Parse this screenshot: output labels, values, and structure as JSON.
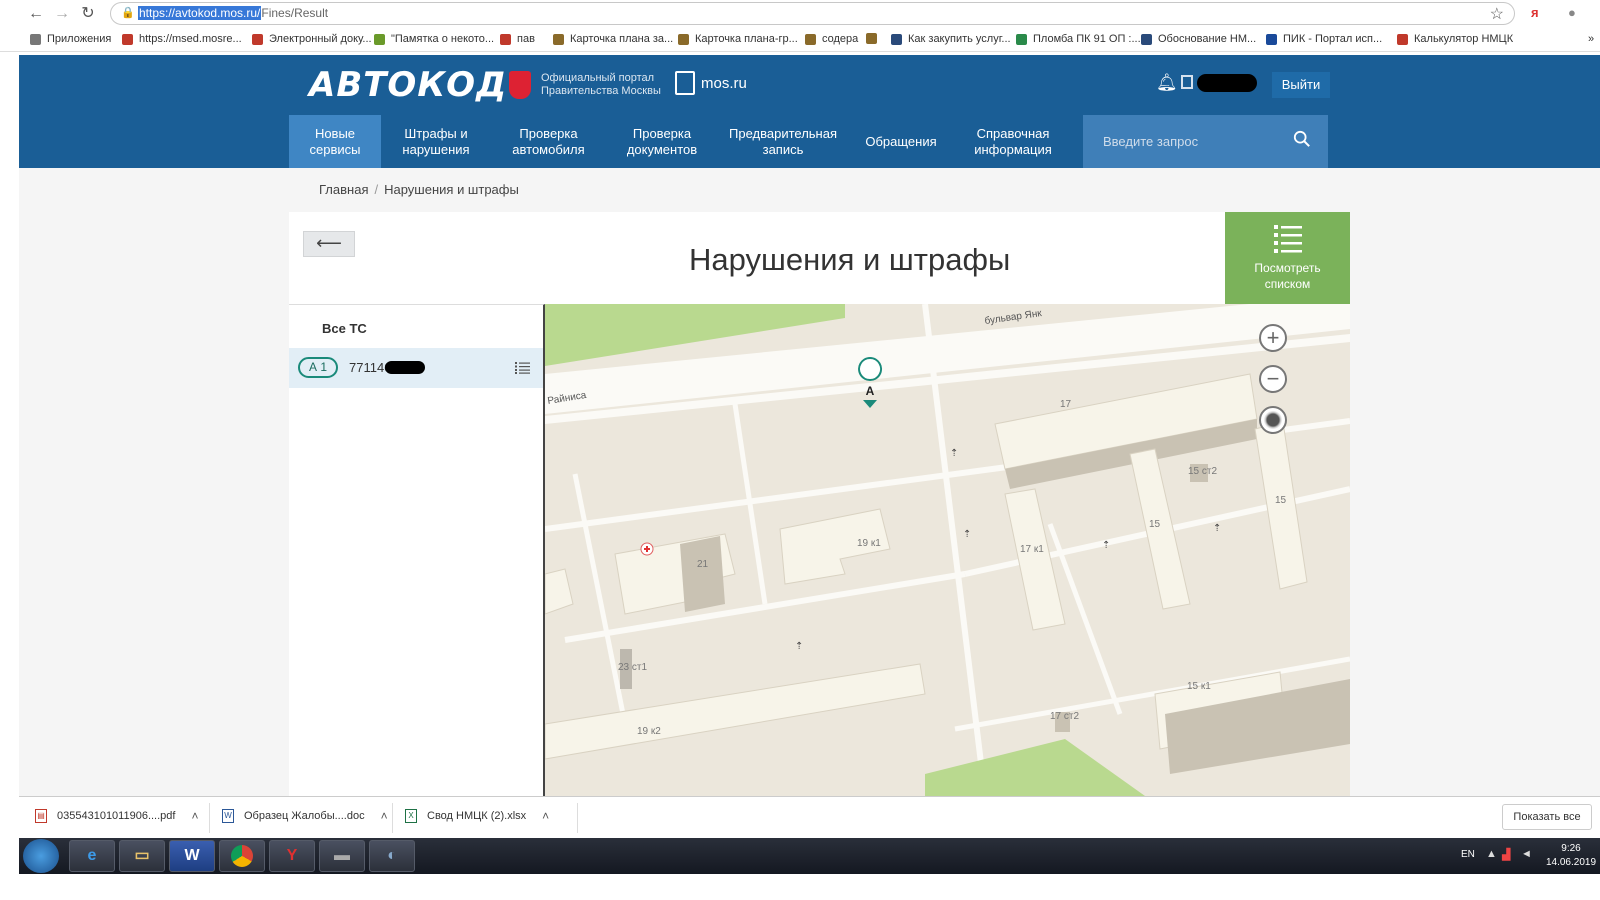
{
  "browser": {
    "url_host": "https://avtokod.mos.ru/",
    "url_path": "Fines/Result",
    "bookmarks": [
      {
        "label": "Приложения",
        "color": "#777777"
      },
      {
        "label": "https://msed.mosre...",
        "color": "#c0392b"
      },
      {
        "label": "Электронный доку...",
        "color": "#c0392b"
      },
      {
        "label": "\"Памятка о некото...",
        "color": "#6a9a2a"
      },
      {
        "label": "пав",
        "color": "#c0392b"
      },
      {
        "label": "Карточка плана за...",
        "color": "#8a6a2a"
      },
      {
        "label": "Карточка плана-гр...",
        "color": "#8a6a2a"
      },
      {
        "label": "содера",
        "color": "#8a6a2a"
      },
      {
        "label": "",
        "color": "#8a6a2a"
      },
      {
        "label": "Как закупить услуг...",
        "color": "#2a4a7a"
      },
      {
        "label": "Пломба ПК 91 ОП :...",
        "color": "#2a8a4a"
      },
      {
        "label": "Обоснование НМ...",
        "color": "#2a4a7a"
      },
      {
        "label": "ПИК - Портал исп...",
        "color": "#1a4a9a"
      },
      {
        "label": "Калькулятор НМЦК",
        "color": "#c0392b"
      }
    ]
  },
  "header": {
    "logo": "АВТОКОД",
    "portal_text": "Официальный портал Правительства Москвы",
    "mosru": "mos.ru",
    "logout": "Выйти"
  },
  "menu": {
    "items": [
      {
        "label": "Новые сервисы",
        "active": true
      },
      {
        "label": "Штрафы и нарушения",
        "active": false
      },
      {
        "label": "Проверка автомобиля",
        "active": false
      },
      {
        "label": "Проверка документов",
        "active": false
      },
      {
        "label": "Предварительная запись",
        "active": false
      },
      {
        "label": "Обращения",
        "active": false
      },
      {
        "label": "Справочная информация",
        "active": false
      }
    ],
    "search_placeholder": "Введите запрос"
  },
  "breadcrumb": {
    "home": "Главная",
    "separator": "/",
    "current": "Нарушения и штрафы"
  },
  "card": {
    "title": "Нарушения и штрафы",
    "back_label": "⟵",
    "list_button": "Посмотреть списком"
  },
  "vehicles": {
    "header": "Все ТС",
    "items": [
      {
        "badge": "А 1",
        "number": "771146"
      }
    ]
  },
  "map": {
    "street_1": "бульвар Янк",
    "street_2": "Райниса",
    "marker": "А",
    "zoom_in": "+",
    "zoom_out": "−",
    "labels": [
      "17",
      "21",
      "19 к1",
      "15 ст2",
      "15",
      "15",
      "17 к1",
      "23 ст1",
      "19 к2",
      "15 к1",
      "17 ст2"
    ]
  },
  "downloads": {
    "items": [
      {
        "name": "035543101011906....pdf",
        "type": "pdf",
        "color": "#c0392b"
      },
      {
        "name": "Образец Жалобы....doc",
        "type": "doc",
        "color": "#2b5797"
      },
      {
        "name": "Свод НМЦК (2).xlsx",
        "type": "xls",
        "color": "#1e7145"
      }
    ],
    "show_all": "Показать все"
  },
  "taskbar": {
    "lang": "EN",
    "time": "9:26",
    "date": "14.06.2019"
  }
}
